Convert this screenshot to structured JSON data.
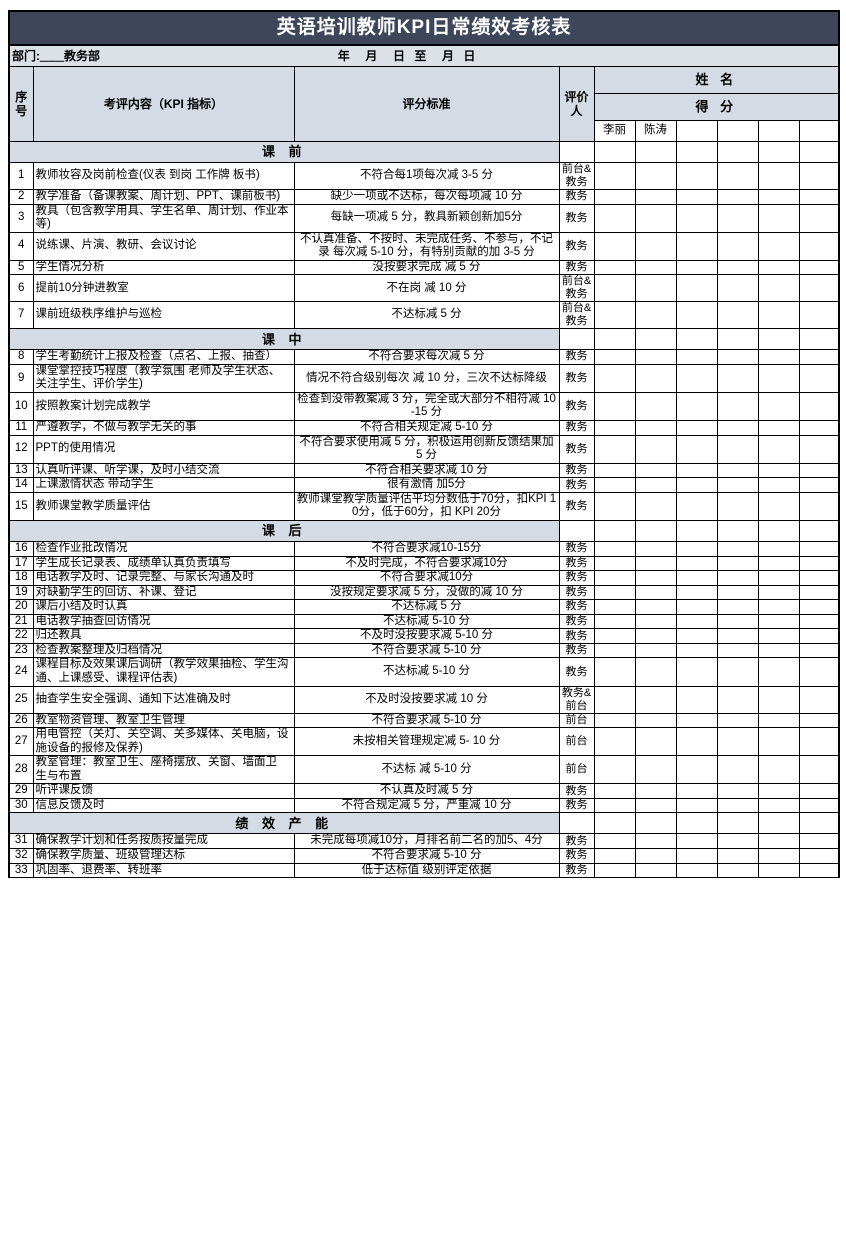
{
  "document": {
    "title": "英语培训教师KPI日常绩效考核表",
    "title_bg": "#3e4659",
    "header_bg": "#d5dbe4",
    "dept_label": "部门:",
    "dept_value": "＿＿教务部",
    "date_line": "年  月  日 至  月 日"
  },
  "columns": {
    "sn": "序\n号",
    "sn_line1": "序",
    "sn_line2": "号",
    "item": "考评内容（KPI 指标）",
    "standard": "评分标准",
    "evaluator_line1": "评价",
    "evaluator_line2": "人",
    "name_group": "姓  名",
    "score_group": "得  分"
  },
  "evaluatees": [
    "李丽",
    "陈涛",
    "",
    "",
    "",
    ""
  ],
  "sections": [
    {
      "label": "课  前",
      "rows": [
        {
          "sn": "1",
          "item": "教师妆容及岗前检查(仪表 到岗 工作牌 板书)",
          "standard": "不符合每1项每次减 3-5 分",
          "evaluator": "前台&\n教务"
        },
        {
          "sn": "2",
          "item": "教学准备（备课教案、周计划、PPT、课前板书)",
          "standard": "缺少一项或不达标，每次每项减 10 分",
          "evaluator": "教务"
        },
        {
          "sn": "3",
          "item": "教具（包含教学用具、学生名单、周计划、作业本等)",
          "standard": "每缺一项减 5 分，教具新颖创新加5分",
          "evaluator": "教务"
        },
        {
          "sn": "4",
          "item": "说练课、片演、教研、会议讨论",
          "standard": "不认真准备、不按时、未完成任务、不参与，不记录 每次减 5-10 分，有特别贡献的加 3-5 分",
          "evaluator": "教务"
        },
        {
          "sn": "5",
          "item": "学生情况分析",
          "standard": "没按要求完成 减 5 分",
          "evaluator": "教务"
        },
        {
          "sn": "6",
          "item": "提前10分钟进教室",
          "standard": "不在岗 减 10 分",
          "evaluator": "前台&\n教务"
        },
        {
          "sn": "7",
          "item": "课前班级秩序维护与巡检",
          "standard": "不达标减 5 分",
          "evaluator": "前台&\n教务"
        }
      ]
    },
    {
      "label": "课  中",
      "rows": [
        {
          "sn": "8",
          "item": "学生考勤统计上报及检查（点名、上报、抽查）",
          "standard": "不符合要求每次减 5 分",
          "evaluator": "教务"
        },
        {
          "sn": "9",
          "item": "课堂掌控技巧程度（教学氛围 老师及学生状态、关注学生、评价学生)",
          "standard": "情况不符合级别每次 减 10 分，三次不达标降级",
          "evaluator": "教务"
        },
        {
          "sn": "10",
          "item": "按照教案计划完成教学",
          "standard": "检查到没带教案减 3 分，完全或大部分不相符减 10-15 分",
          "evaluator": "教务"
        },
        {
          "sn": "11",
          "item": "严遵教学，不做与教学无关的事",
          "standard": "不符合相关规定减 5-10 分",
          "evaluator": "教务"
        },
        {
          "sn": "12",
          "item": "PPT的使用情况",
          "standard": "不符合要求使用减 5 分，积极运用创新反馈结果加 5 分",
          "evaluator": "教务"
        },
        {
          "sn": "13",
          "item": "认真听评课、听学课，及时小结交流",
          "standard": "不符合相关要求减 10 分",
          "evaluator": "教务"
        },
        {
          "sn": "14",
          "item": "上课激情状态 带动学生",
          "standard": "很有激情 加5分",
          "evaluator": "教务"
        },
        {
          "sn": "15",
          "item": "教师课堂教学质量评估",
          "standard": "教师课堂教学质量评估平均分数低于70分，扣KPI 10分，低于60分，扣 KPI 20分",
          "evaluator": "教务"
        }
      ]
    },
    {
      "label": "课  后",
      "rows": [
        {
          "sn": "16",
          "item": "检查作业批改情况",
          "standard": "不符合要求减10-15分",
          "evaluator": "教务"
        },
        {
          "sn": "17",
          "item": "学生成长记录表、成绩单认真负责填写",
          "standard": "不及时完成，不符合要求减10分",
          "evaluator": "教务"
        },
        {
          "sn": "18",
          "item": "电话教学及时、记录完整、与家长沟通及时",
          "standard": "不符合要求减10分",
          "evaluator": "教务"
        },
        {
          "sn": "19",
          "item": "对缺勤学生的回访、补课、登记",
          "standard": "没按规定要求减 5 分，没做的减 10 分",
          "evaluator": "教务"
        },
        {
          "sn": "20",
          "item": "课后小结及时认真",
          "standard": "不达标减 5 分",
          "evaluator": "教务"
        },
        {
          "sn": "21",
          "item": "电话教学抽查回访情况",
          "standard": "不达标减 5-10 分",
          "evaluator": "教务"
        },
        {
          "sn": "22",
          "item": "归还教具",
          "standard": "不及时没按要求减 5-10 分",
          "evaluator": "教务"
        },
        {
          "sn": "23",
          "item": "检查教案整理及归档情况",
          "standard": "不符合要求减 5-10 分",
          "evaluator": "教务"
        },
        {
          "sn": "24",
          "item": "课程目标及效果课后调研（教学效果抽检、学生沟通、上课感受、课程评估表)",
          "standard": "不达标减 5-10 分",
          "evaluator": "教务"
        },
        {
          "sn": "25",
          "item": "抽查学生安全强调、通知下达准确及时",
          "standard": "不及时没按要求减 10 分",
          "evaluator": "教务&\n前台"
        },
        {
          "sn": "26",
          "item": "教室物资管理、教室卫生管理",
          "standard": "不符合要求减 5-10 分",
          "evaluator": "前台"
        },
        {
          "sn": "27",
          "item": "  用电管控（关灯、关空调、关多媒体、关电脑，设施设备的报修及保养)",
          "standard": "未按相关管理规定减 5- 10 分",
          "evaluator": "前台"
        },
        {
          "sn": "28",
          "item": " 教室管理：教室卫生、座椅摆放、关窗、墙面卫 生与布置",
          "standard": "不达标 减 5-10 分",
          "evaluator": "前台"
        },
        {
          "sn": "29",
          "item": "听评课反馈",
          "standard": "不认真及时减 5 分",
          "evaluator": "教务"
        },
        {
          "sn": "30",
          "item": "信息反馈及时",
          "standard": "不符合规定减 5 分，严重减 10 分",
          "evaluator": "教务"
        }
      ]
    },
    {
      "label": "绩  效  产  能",
      "rows": [
        {
          "sn": "31",
          "item": "确保教学计划和任务按质按量完成",
          "standard": "未完成每项减10分，月排名前二名的加5、4分",
          "evaluator": "教务"
        },
        {
          "sn": "32",
          "item": "确保教学质量、班级管理达标",
          "standard": "不符合要求减 5-10 分",
          "evaluator": "教务"
        },
        {
          "sn": "33",
          "item": "巩固率、退费率、转班率",
          "standard": "低于达标值 级别评定依据",
          "evaluator": "教务"
        }
      ]
    }
  ]
}
